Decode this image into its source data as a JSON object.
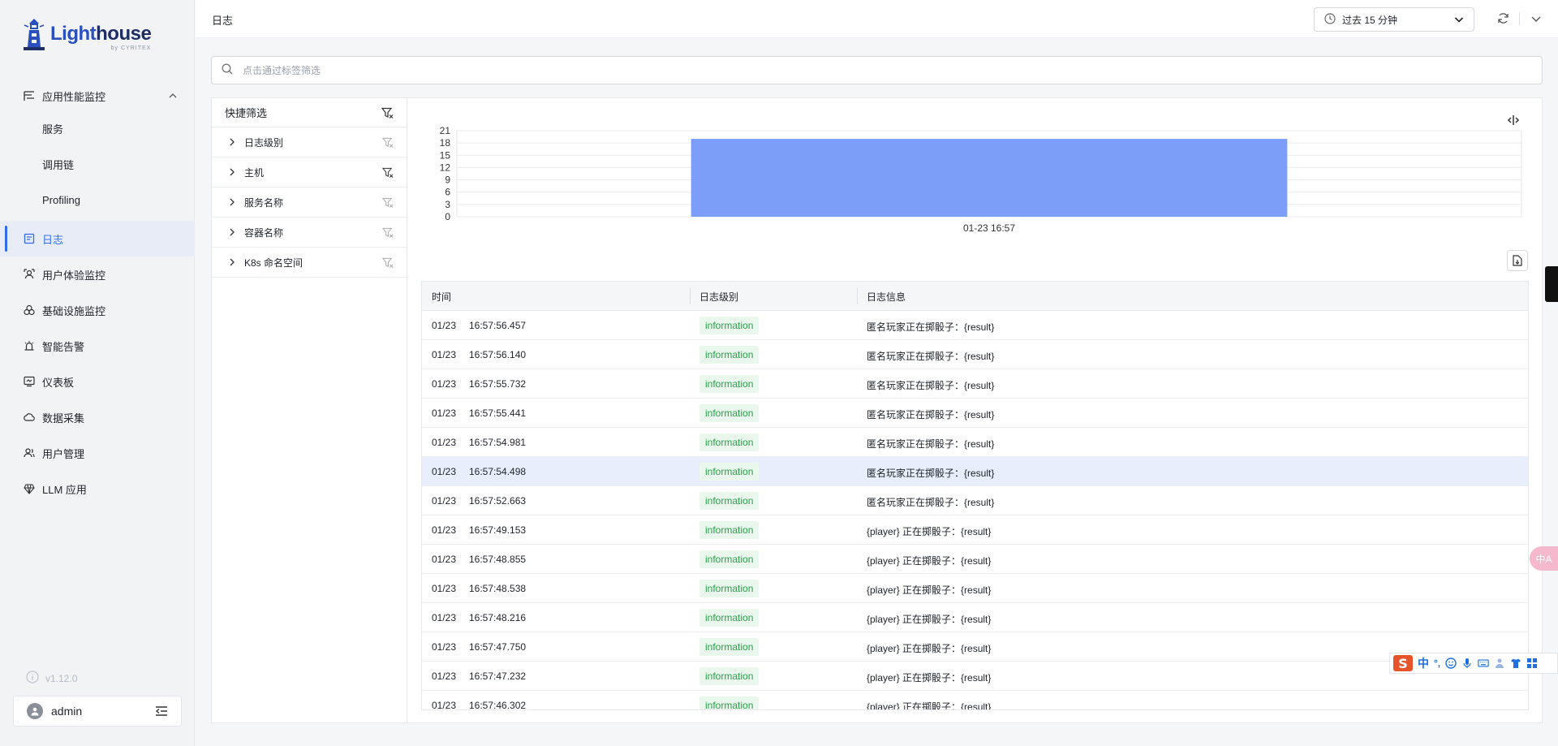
{
  "brand": {
    "name_part1": "Light",
    "name_part2": "house",
    "sub": "by CYRITEX"
  },
  "sidebar": {
    "group_label": "应用性能监控",
    "sub_items": [
      {
        "label": "服务"
      },
      {
        "label": "调用链"
      },
      {
        "label": "Profiling"
      }
    ],
    "items": [
      {
        "label": "日志",
        "icon": "log-icon",
        "active": true
      },
      {
        "label": "用户体验监控",
        "icon": "user-experience-icon"
      },
      {
        "label": "基础设施监控",
        "icon": "infrastructure-icon"
      },
      {
        "label": "智能告警",
        "icon": "alarm-icon"
      },
      {
        "label": "仪表板",
        "icon": "dashboard-icon"
      },
      {
        "label": "数据采集",
        "icon": "data-collection-icon"
      },
      {
        "label": "用户管理",
        "icon": "user-management-icon"
      },
      {
        "label": "LLM 应用",
        "icon": "llm-icon"
      }
    ],
    "version": "v1.12.0",
    "user": "admin"
  },
  "header": {
    "title": "日志",
    "time_range": "过去 15 分钟"
  },
  "search": {
    "placeholder": "点击通过标签筛选"
  },
  "filters": {
    "title": "快捷筛选",
    "rows": [
      {
        "label": "日志级别"
      },
      {
        "label": "主机"
      },
      {
        "label": "服务名称"
      },
      {
        "label": "容器名称"
      },
      {
        "label": "K8s 命名空间"
      }
    ]
  },
  "chart_data": {
    "type": "bar",
    "categories": [
      "01-23 16:57"
    ],
    "values": [
      19
    ],
    "title": "",
    "xlabel": "",
    "ylabel": "",
    "ylim": [
      0,
      21
    ],
    "yticks": [
      0,
      3,
      6,
      9,
      12,
      15,
      18,
      21
    ],
    "grid": true,
    "bar_color": "#7d9ef8"
  },
  "table": {
    "columns": [
      "时间",
      "日志级别",
      "日志信息"
    ],
    "rows": [
      {
        "date": "01/23",
        "time": "16:57:56.457",
        "level": "information",
        "message": "匿名玩家正在掷骰子：{result}"
      },
      {
        "date": "01/23",
        "time": "16:57:56.140",
        "level": "information",
        "message": "匿名玩家正在掷骰子：{result}"
      },
      {
        "date": "01/23",
        "time": "16:57:55.732",
        "level": "information",
        "message": "匿名玩家正在掷骰子：{result}"
      },
      {
        "date": "01/23",
        "time": "16:57:55.441",
        "level": "information",
        "message": "匿名玩家正在掷骰子：{result}"
      },
      {
        "date": "01/23",
        "time": "16:57:54.981",
        "level": "information",
        "message": "匿名玩家正在掷骰子：{result}"
      },
      {
        "date": "01/23",
        "time": "16:57:54.498",
        "level": "information",
        "message": "匿名玩家正在掷骰子：{result}",
        "highlight": true
      },
      {
        "date": "01/23",
        "time": "16:57:52.663",
        "level": "information",
        "message": "匿名玩家正在掷骰子：{result}"
      },
      {
        "date": "01/23",
        "time": "16:57:49.153",
        "level": "information",
        "message": "{player} 正在掷骰子：{result}"
      },
      {
        "date": "01/23",
        "time": "16:57:48.855",
        "level": "information",
        "message": "{player} 正在掷骰子：{result}"
      },
      {
        "date": "01/23",
        "time": "16:57:48.538",
        "level": "information",
        "message": "{player} 正在掷骰子：{result}"
      },
      {
        "date": "01/23",
        "time": "16:57:48.216",
        "level": "information",
        "message": "{player} 正在掷骰子：{result}"
      },
      {
        "date": "01/23",
        "time": "16:57:47.750",
        "level": "information",
        "message": "{player} 正在掷骰子：{result}"
      },
      {
        "date": "01/23",
        "time": "16:57:47.232",
        "level": "information",
        "message": "{player} 正在掷骰子：{result}"
      },
      {
        "date": "01/23",
        "time": "16:57:46.302",
        "level": "information",
        "message": "{player} 正在掷骰子：{result}"
      }
    ]
  },
  "widgets": {
    "translate_label": "中A",
    "ime_logo": "S",
    "ime_mode": "中",
    "ime_punct": "°,"
  }
}
